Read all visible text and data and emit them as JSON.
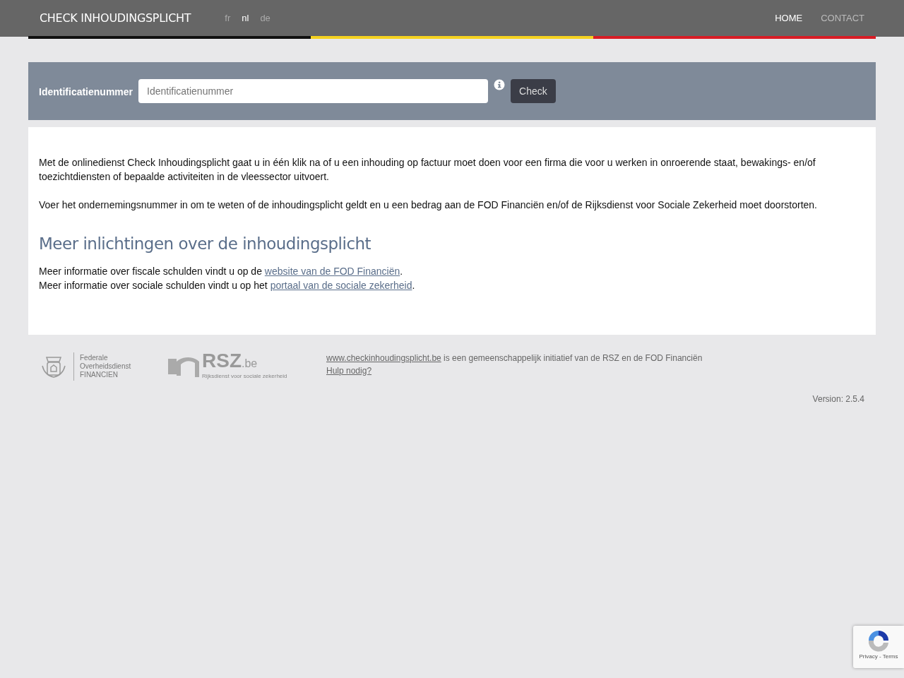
{
  "navbar": {
    "brand": "CHECK INHOUDINGSPLICHT",
    "languages": [
      {
        "label": "fr",
        "selected": false
      },
      {
        "label": "nl",
        "selected": true
      },
      {
        "label": "de",
        "selected": false
      }
    ],
    "menu": [
      {
        "label": "HOME",
        "selected": true
      },
      {
        "label": "CONTACT",
        "selected": false
      }
    ]
  },
  "search": {
    "label": "Identificatienummer",
    "placeholder": "Identificatienummer",
    "button": "Check"
  },
  "intro": [
    "Met de onlinedienst Check Inhoudingsplicht gaat u in één klik na of u een inhouding op factuur moet doen voor een firma die voor u werken in onroerende staat, bewakings- en/of toezichtdiensten of bepaalde activiteiten in de vleessector uitvoert.",
    "Voer het ondernemingsnummer in om te weten of de inhoudingsplicht geldt en u een bedrag aan de FOD Financiën en/of de Rijksdienst voor Sociale Zekerheid moet doorstorten."
  ],
  "more_info": {
    "heading": "Meer inlichtingen over de inhoudingsplicht",
    "lines": [
      {
        "before": "Meer informatie over fiscale schulden vindt u op de ",
        "link": "website van de FOD Financiën",
        "after": "."
      },
      {
        "before": "Meer informatie over sociale schulden vindt u op het ",
        "link": "portaal van de sociale zekerheid",
        "after": "."
      }
    ]
  },
  "footer": {
    "fod_logo": [
      "Federale",
      "Overheidsdienst",
      "FINANCIEN"
    ],
    "rsz_logo": {
      "name": "RSZ",
      "suffix": ".be",
      "tagline": "Rijksdienst voor sociale zekerheid"
    },
    "site_link": "www.checkinhoudingsplicht.be",
    "site_text": " is een gemeenschappelijk initiatief van de RSZ en de FOD Financiën",
    "help_link": "Hulp nodig?",
    "version": "Version: 2.5.4"
  },
  "recaptcha": {
    "links": "Privacy - Terms"
  }
}
